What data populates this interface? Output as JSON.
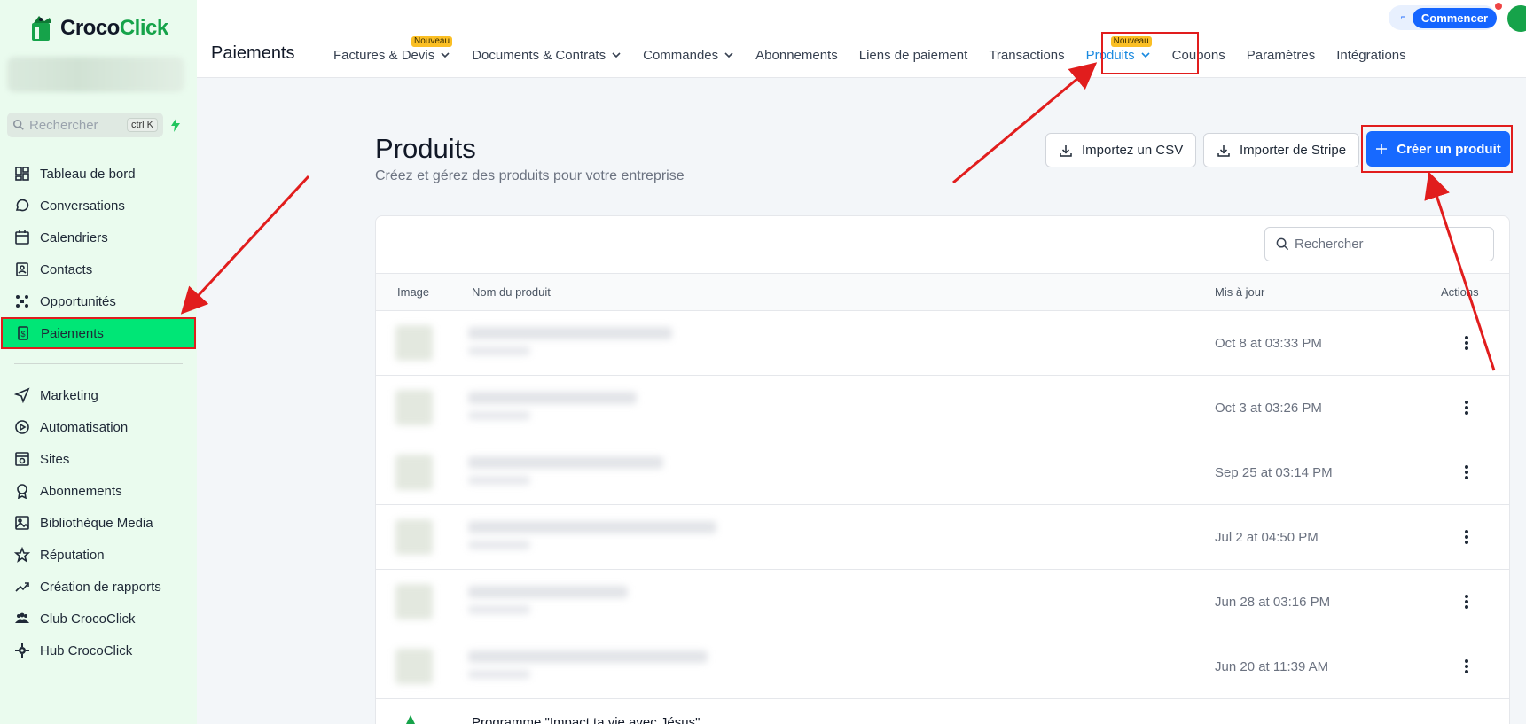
{
  "brand": {
    "name_part1": "Croco",
    "name_part2": "Click",
    "accent": "#16a34a"
  },
  "sidebar": {
    "search_placeholder": "Rechercher",
    "search_shortcut": "ctrl K",
    "items_top": [
      {
        "label": "Tableau de bord",
        "icon": "dashboard-icon"
      },
      {
        "label": "Conversations",
        "icon": "chat-icon"
      },
      {
        "label": "Calendriers",
        "icon": "calendar-icon"
      },
      {
        "label": "Contacts",
        "icon": "contacts-icon"
      },
      {
        "label": "Opportunités",
        "icon": "opportunities-icon"
      },
      {
        "label": "Paiements",
        "icon": "payments-icon",
        "active": true
      }
    ],
    "items_bottom": [
      {
        "label": "Marketing",
        "icon": "send-icon"
      },
      {
        "label": "Automatisation",
        "icon": "automation-icon"
      },
      {
        "label": "Sites",
        "icon": "sites-icon"
      },
      {
        "label": "Abonnements",
        "icon": "badge-icon"
      },
      {
        "label": "Bibliothèque Media",
        "icon": "image-icon"
      },
      {
        "label": "Réputation",
        "icon": "star-icon"
      },
      {
        "label": "Création de rapports",
        "icon": "trend-icon"
      },
      {
        "label": "Club CrocoClick",
        "icon": "group-icon"
      },
      {
        "label": "Hub CrocoClick",
        "icon": "gear-icon"
      }
    ]
  },
  "topbar": {
    "title": "Paiements",
    "tabs": [
      {
        "label": "Factures & Devis",
        "dropdown": true,
        "badge": "Nouveau"
      },
      {
        "label": "Documents & Contrats",
        "dropdown": true
      },
      {
        "label": "Commandes",
        "dropdown": true
      },
      {
        "label": "Abonnements"
      },
      {
        "label": "Liens de paiement"
      },
      {
        "label": "Transactions"
      },
      {
        "label": "Produits",
        "dropdown": true,
        "badge": "Nouveau",
        "active": true
      },
      {
        "label": "Coupons"
      },
      {
        "label": "Paramètres"
      },
      {
        "label": "Intégrations"
      }
    ],
    "cta_label": "Commencer"
  },
  "main": {
    "title": "Produits",
    "subtitle": "Créez et gérez des produits pour votre entreprise",
    "import_csv_label": "Importez un CSV",
    "import_stripe_label": "Importer de Stripe",
    "create_label": "Créer un produit",
    "table_search_placeholder": "Rechercher",
    "columns": {
      "image": "Image",
      "name": "Nom du produit",
      "updated": "Mis à jour",
      "actions": "Actions"
    },
    "rows": [
      {
        "name": "",
        "updated": "Oct 8 at 03:33 PM"
      },
      {
        "name": "",
        "updated": "Oct 3 at 03:26 PM"
      },
      {
        "name": "",
        "updated": "Sep 25 at 03:14 PM"
      },
      {
        "name": "",
        "updated": "Jul 2 at 04:50 PM"
      },
      {
        "name": "",
        "updated": "Jun 28 at 03:16 PM"
      },
      {
        "name": "",
        "updated": "Jun 20 at 11:39 AM"
      },
      {
        "name": "Programme \"Impact ta vie avec Jésus\"",
        "updated": ""
      }
    ]
  }
}
